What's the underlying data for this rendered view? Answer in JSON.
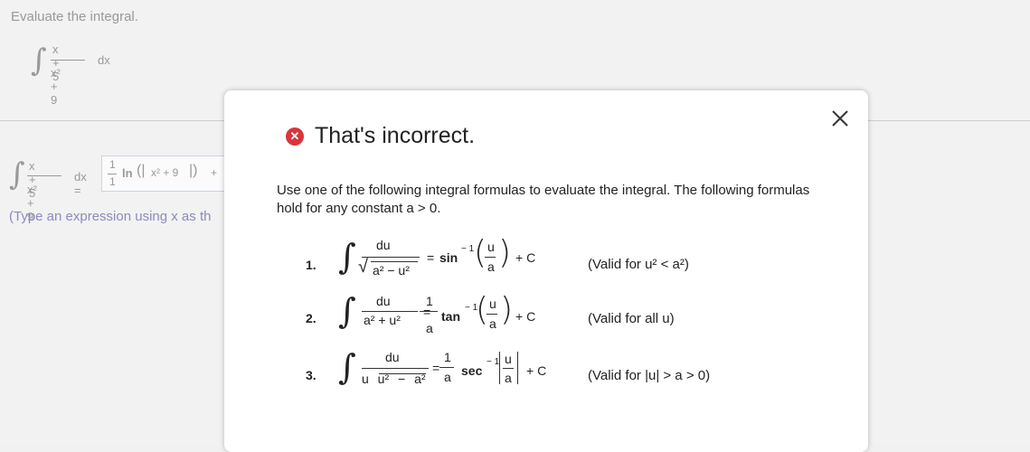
{
  "background": {
    "instruction": "Evaluate the integral.",
    "integral": {
      "numerator": "x + 5",
      "denominator": "x² + 9",
      "dx": "dx"
    },
    "answer_line": {
      "numerator": "x + 5",
      "denominator": "x² + 9",
      "dx_eq": "dx =",
      "coef_num": "1",
      "coef_den": "1",
      "ln_text": "ln",
      "abs_arg": "x² + 9",
      "plus": "+"
    },
    "type_note": "(Type an expression using x as th"
  },
  "modal": {
    "status": "That's incorrect.",
    "instruction": "Use one of the following integral formulas to evaluate the integral. The following formulas hold for any constant a > 0.",
    "formulas": [
      {
        "number": "1.",
        "numerator": "du",
        "denominator": "a² − u²",
        "equals": "=",
        "func": "sin",
        "exp": "− 1",
        "arg_num": "u",
        "arg_den": "a",
        "plus_c": "+ C",
        "valid": "(Valid for u² < a²)"
      },
      {
        "number": "2.",
        "numerator": "du",
        "denominator": "a² + u²",
        "equals": "=",
        "coef_num": "1",
        "coef_den": "a",
        "func": "tan",
        "exp": "− 1",
        "arg_num": "u",
        "arg_den": "a",
        "plus_c": "+ C",
        "valid": "(Valid for all u)"
      },
      {
        "number": "3.",
        "numerator": "du",
        "denominator": "u u² − a²",
        "equals": "=",
        "coef_num": "1",
        "coef_den": "a",
        "func": "sec",
        "exp": "− 1",
        "arg_num": "u",
        "arg_den": "a",
        "plus_c": "+ C",
        "valid": "(Valid for |u| > a > 0)"
      }
    ]
  },
  "colors": {
    "error": "#d9353b",
    "muted_text": "#999999",
    "note_text": "#8a8ac0"
  },
  "icons": {
    "close": "close-icon",
    "status": "error-x-circle-icon"
  }
}
